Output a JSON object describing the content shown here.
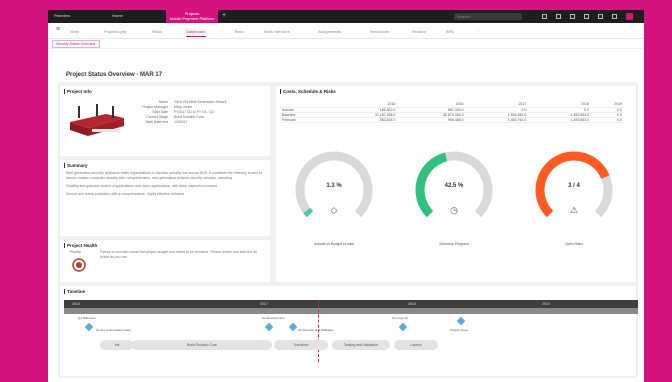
{
  "topbar": {
    "logo": "Planview",
    "tab_home": "Home",
    "tab_active_line1": "Projects",
    "tab_active_line2": "Mobile Payment Platform",
    "plus": "+",
    "search": "Search"
  },
  "nav": {
    "items": [
      "Work",
      "Projects grid",
      "Risks",
      "Dashboard",
      "Team",
      "Work Services",
      "Assignments",
      "Resources",
      "Finance",
      "BPA"
    ]
  },
  "subtab": "Security Status Overview",
  "page_title": "Project Status Overview - MAR 17",
  "project_info": {
    "heading": "Project Info",
    "rows": [
      {
        "k": "Name",
        "v": "2016 GN Next Generation Securit"
      },
      {
        "k": "Project Manager",
        "v": "Mary Jones"
      },
      {
        "k": "Start Date",
        "v": "FY2017 Q1 to FY 03 - Q2"
      },
      {
        "k": "Current Stage",
        "v": "Build Solution Core"
      },
      {
        "k": "Task Date end",
        "v": "12/04/17"
      }
    ]
  },
  "summary": {
    "heading": "Summary",
    "p1": "Next generation security appliance helps organizations to harness security risk across DHS. It combines the intensity it used to secure modern computer security with comprehensive, next generation network security services, including.",
    "p2": "Visibility and granular control of applications and micro-applications, with deep inspection protocol.",
    "p3": "Secure and threat protection with a comprehensive, highly effective intrusion."
  },
  "health": {
    "heading": "Project Health",
    "label": "Priority",
    "text": "Failure to consider above the project budget risk needs to be resolved. Please review and take the all action as you can."
  },
  "costs": {
    "heading": "Costs, Schedule & Risks",
    "years": [
      "",
      "2016",
      "2016",
      "2017",
      "2018",
      "2019",
      "2019"
    ],
    "rows": [
      {
        "label": "Actuals",
        "values": [
          "166,822.0",
          "661,300.0",
          "0.0",
          "0.0",
          "0.0"
        ]
      },
      {
        "label": "Baseline",
        "values": [
          "37,187,258.0",
          "36,879,354.0",
          "1,834,352.0",
          "1,452,853.0",
          "0.0"
        ]
      },
      {
        "label": "Forecast",
        "values": [
          "283,824.0",
          "965,488.0",
          "1,465,764.0",
          "1,459,863.0",
          "0.0"
        ]
      }
    ]
  },
  "gauges": [
    {
      "value": "1.3 %",
      "label": "Actuals vs Budget to date",
      "fraction": 0.03,
      "color": "#4fc7a8",
      "icon": "money-icon",
      "glyph": "◇"
    },
    {
      "value": "42.5 %",
      "label": "Schedule Progress",
      "fraction": 0.45,
      "color": "#2ec27e",
      "icon": "clock-icon",
      "glyph": "◷"
    },
    {
      "value": "3 / 4",
      "label": "Open Risks",
      "fraction": 0.75,
      "color": "#ff5a1f",
      "icon": "warning-icon",
      "glyph": "⚠"
    }
  ],
  "timeline": {
    "heading": "Timeline",
    "years": [
      "2016",
      "2017",
      "2018",
      "2019"
    ],
    "milestones": [
      {
        "label": "Q1 Milestone",
        "label2": "Go-live Authorization Date"
      },
      {
        "label": "Go-Development",
        "label2": "Go-Develop and Validated"
      },
      {
        "label": "Go-to-go Kit",
        "label2": ""
      },
      {
        "label": "Project Close",
        "label2": ""
      }
    ],
    "bars": [
      "Init",
      "Build Solution Core",
      "Transition",
      "Testing and Validation",
      "Launch"
    ]
  }
}
